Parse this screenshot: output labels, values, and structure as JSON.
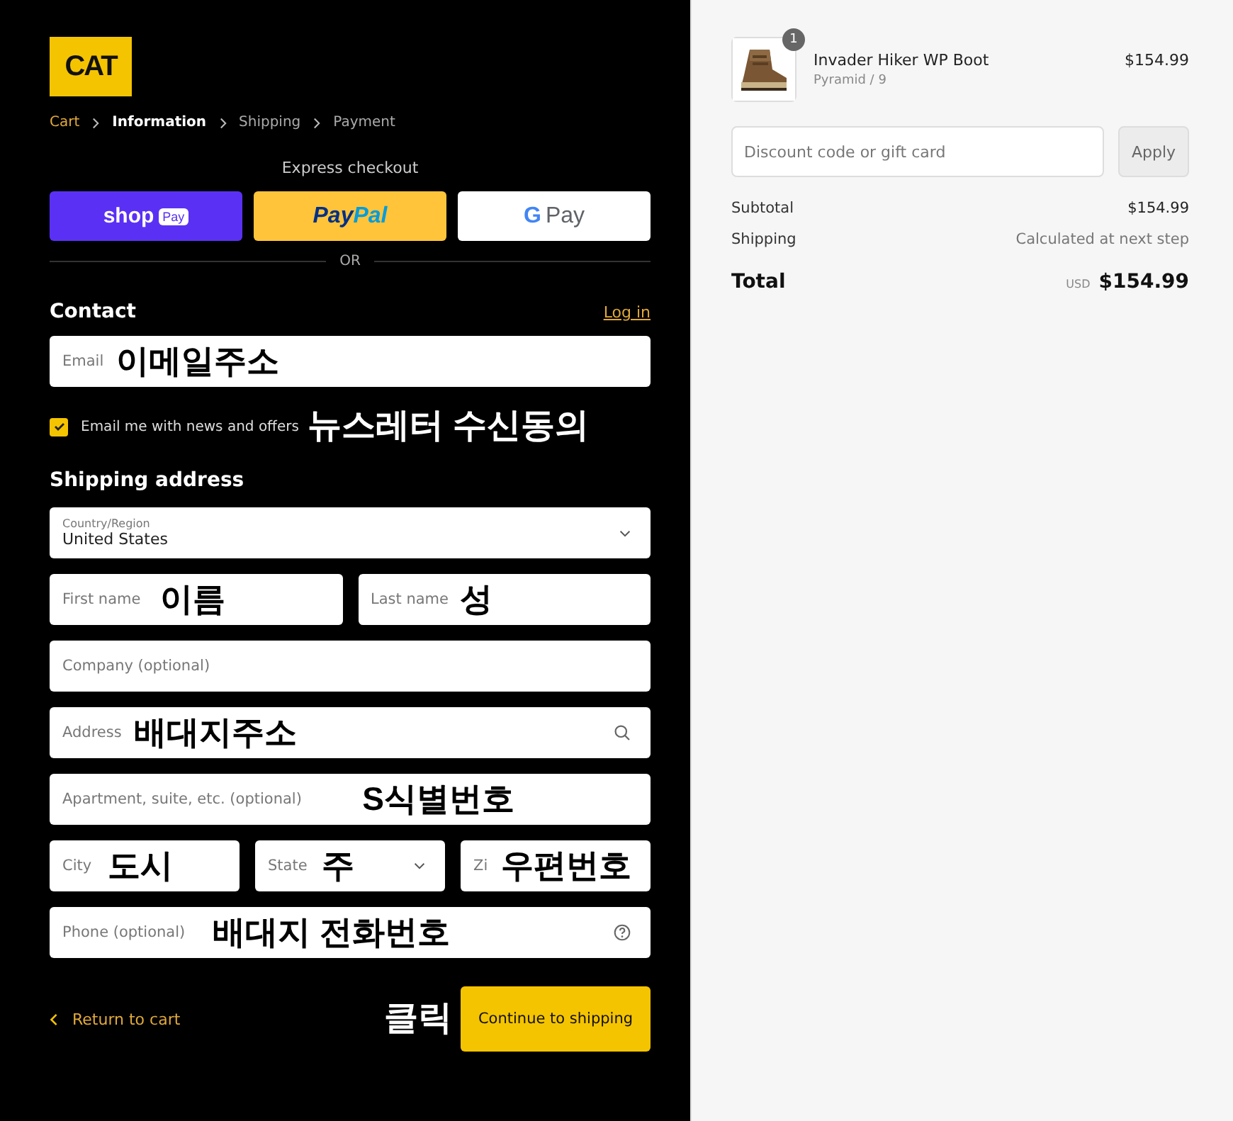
{
  "logo": {
    "text": "CAT"
  },
  "breadcrumb": [
    {
      "label": "Cart",
      "selected": false,
      "completed": true
    },
    {
      "label": "Information",
      "selected": true,
      "completed": false
    },
    {
      "label": "Shipping",
      "selected": false,
      "completed": false
    },
    {
      "label": "Payment",
      "selected": false,
      "completed": false
    }
  ],
  "express_checkout": {
    "title": "Express checkout",
    "buttons": [
      {
        "kind": "shop",
        "text": "shop",
        "badge": "Pay"
      },
      {
        "kind": "paypal",
        "text": "Pay",
        "text2": "Pal"
      },
      {
        "kind": "gpay",
        "text": "G",
        "text2": "Pay"
      }
    ],
    "divider": "OR"
  },
  "contact": {
    "title": "Contact",
    "login": "Log in",
    "email": {
      "placeholder": "Email",
      "annotation": "이메일주소"
    },
    "newsletter": {
      "label": "Email me with news and offers",
      "checked": true,
      "annotation": "뉴스레터 수신동의"
    }
  },
  "shipping_address": {
    "title": "Shipping address",
    "rows": [
      [
        {
          "kind": "select",
          "label": "Country/Region",
          "value": "United States"
        }
      ],
      [
        {
          "kind": "text",
          "placeholder": "First name",
          "annotation": "이름"
        },
        {
          "kind": "text",
          "placeholder": "Last name",
          "annotation": "성"
        }
      ],
      [
        {
          "kind": "text",
          "placeholder": "Company (optional)"
        }
      ],
      [
        {
          "kind": "search",
          "placeholder": "Address",
          "annotation": "배대지주소"
        }
      ],
      [
        {
          "kind": "text",
          "placeholder": "Apartment, suite, etc. (optional)",
          "annotation": "S식별번호"
        }
      ],
      [
        {
          "kind": "text",
          "placeholder": "City",
          "annotation": "도시"
        },
        {
          "kind": "select",
          "placeholder": "State",
          "annotation": "주"
        },
        {
          "kind": "text",
          "placeholder": "Zi",
          "annotation": "우편번호"
        }
      ],
      [
        {
          "kind": "help",
          "placeholder": "Phone (optional)",
          "annotation": "배대지 전화번호"
        }
      ]
    ]
  },
  "footer": {
    "return_link": "Return to cart",
    "annotation": "클릭",
    "continue_button": "Continue to shipping"
  },
  "summary": {
    "item": {
      "name": "Invader Hiker WP Boot",
      "variant": "Pyramid / 9",
      "price": "$154.99",
      "quantity": "1"
    },
    "discount": {
      "placeholder": "Discount code or gift card",
      "button": "Apply"
    },
    "lines": [
      {
        "label": "Subtotal",
        "value": "$154.99",
        "kind": "price"
      },
      {
        "label": "Shipping",
        "value": "Calculated at next step",
        "kind": "note"
      }
    ],
    "total": {
      "label": "Total",
      "currency": "USD",
      "value": "$154.99"
    }
  }
}
